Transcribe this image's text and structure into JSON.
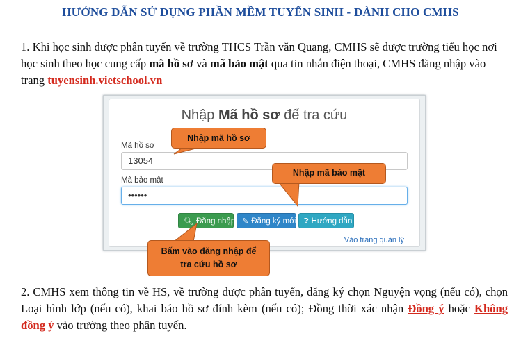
{
  "title": "HƯỚNG DẪN SỬ DỤNG PHẦN MỀM TUYỂN SINH  - DÀNH CHO CMHS",
  "step1": {
    "text_a": "1. Khi học sinh được phân tuyến về trường THCS Trần văn Quang, CMHS sẽ được trường tiểu học nơi học sinh theo học cung cấp ",
    "bold1": "mã hồ sơ",
    "text_b": " và ",
    "bold2": "mã bảo mật",
    "text_c": " qua tin nhắn điện thoại, CMHS đăng nhập vào trang ",
    "link": "tuyensinh.vietschool.vn"
  },
  "form": {
    "heading_a": "Nhập ",
    "heading_bold": "Mã hồ sơ",
    "heading_b": " để tra cứu",
    "field1_label": "Mã hồ sơ",
    "field1_value": "13054",
    "field2_label": "Mã bảo mật",
    "field2_value": "••••••",
    "btn_login": "Đăng nhập",
    "btn_register": "Đăng ký mới",
    "btn_help": "Hướng dẫn",
    "admin_link": "Vào trang quản lý"
  },
  "callouts": {
    "enter_code": "Nhập mã hồ sơ",
    "enter_password": "Nhập mã bảo mật",
    "click_login_line1": "Bấm vào đăng nhập để",
    "click_login_line2": "tra cứu hồ sơ"
  },
  "step2": {
    "text_a": "2. CMHS xem thông tin về HS, về trường được phân tuyến, đăng ký chọn Nguyện vọng (nếu có), chọn Loại hình lớp (nếu có), khai báo hồ sơ đính kèm (nếu có); Đồng thời xác nhận ",
    "agree": "Đồng ý",
    "text_b": " hoặc ",
    "disagree": "Không đồng ý",
    "text_c": " vào trường theo phân tuyến."
  },
  "colors": {
    "title": "#1f4e9c",
    "link": "#d42a1e",
    "callout": "#ee7d34",
    "btn_green": "#3b9b4f",
    "btn_blue": "#2f86c8",
    "btn_teal": "#2fa7c2"
  }
}
